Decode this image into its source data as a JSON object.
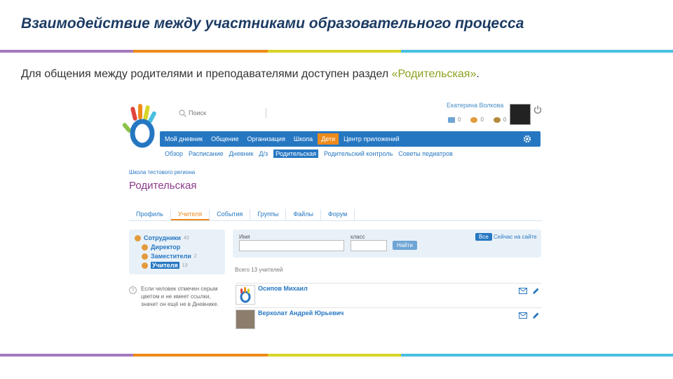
{
  "slide": {
    "title": "Взаимодействие между участниками образовательного процесса",
    "subtitle_prefix": "Для общения между родителями и преподавателями доступен раздел ",
    "subtitle_highlight": "«Родительская»",
    "subtitle_suffix": ".",
    "stripe_colors": [
      "#a679c0",
      "#ef8a1a",
      "#d8d428",
      "#49bfe0"
    ]
  },
  "app": {
    "search_placeholder": "Поиск",
    "user_name": "Екатерина Волкова",
    "counters": [
      "0",
      "0",
      "0"
    ],
    "nav": [
      {
        "label": "Мой дневник",
        "active": false
      },
      {
        "label": "Общение",
        "active": false
      },
      {
        "label": "Организация",
        "active": false
      },
      {
        "label": "Школа",
        "active": false
      },
      {
        "label": "Дети",
        "active": true
      },
      {
        "label": "Центр приложений",
        "active": false
      }
    ],
    "subnav": [
      {
        "label": "Обзор",
        "active": false
      },
      {
        "label": "Расписание",
        "active": false
      },
      {
        "label": "Дневник",
        "active": false
      },
      {
        "label": "Д/з",
        "active": false
      },
      {
        "label": "Родительская",
        "active": true
      },
      {
        "label": "Родительский контроль",
        "active": false
      },
      {
        "label": "Советы педиатров",
        "active": false
      }
    ],
    "school_name": "Школа тестового региона",
    "page_title": "Родительская",
    "tabs": [
      {
        "label": "Профиль",
        "active": false
      },
      {
        "label": "Учителя",
        "active": true
      },
      {
        "label": "События",
        "active": false
      },
      {
        "label": "Группы",
        "active": false
      },
      {
        "label": "Файлы",
        "active": false
      },
      {
        "label": "Форум",
        "active": false
      }
    ],
    "sidebar": [
      {
        "label": "Сотрудники",
        "count": "42"
      },
      {
        "label": "Директор",
        "count": ""
      },
      {
        "label": "Заместители",
        "count": "2"
      },
      {
        "label": "Учителя",
        "count": "13"
      }
    ],
    "filter": {
      "name_label": "Имя",
      "class_label": "класс",
      "find_button": "Найти",
      "all_button": "Все",
      "online_link": "Сейчас на сайте"
    },
    "total": "Всего 13 учителей",
    "help_text": "Если человек отмечен серым цветом и не имеет ссылки, значит он ещё не в Дневнике.",
    "people": [
      {
        "name": "Осипов Михаил"
      },
      {
        "name": "Верхолат Андрей Юрьевич"
      }
    ]
  }
}
